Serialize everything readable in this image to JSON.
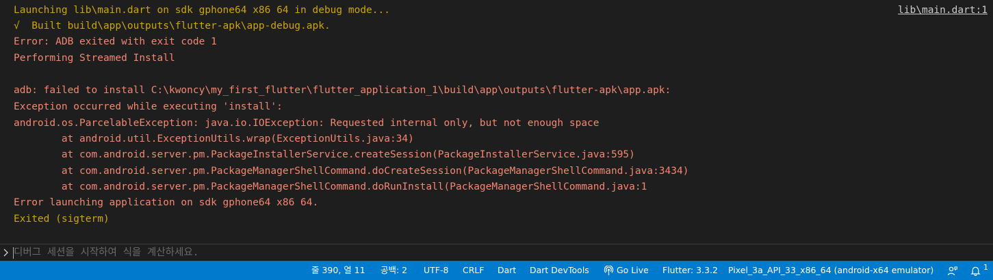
{
  "console": {
    "lines": [
      {
        "text": "Launching lib\\main.dart on sdk gphone64 x86 64 in debug mode...",
        "tone": "yellow"
      },
      {
        "text": "√  Built build\\app\\outputs\\flutter-apk\\app-debug.apk.",
        "tone": "yellow"
      },
      {
        "text": "Error: ADB exited with exit code 1",
        "tone": "red"
      },
      {
        "text": "Performing Streamed Install",
        "tone": "red"
      },
      {
        "text": "",
        "tone": "red"
      },
      {
        "text": "adb: failed to install C:\\kwoncy\\my_first_flutter\\flutter_application_1\\build\\app\\outputs\\flutter-apk\\app.apk:",
        "tone": "red"
      },
      {
        "text": "Exception occurred while executing 'install':",
        "tone": "red"
      },
      {
        "text": "android.os.ParcelableException: java.io.IOException: Requested internal only, but not enough space",
        "tone": "red"
      },
      {
        "text": "        at android.util.ExceptionUtils.wrap(ExceptionUtils.java:34)",
        "tone": "red"
      },
      {
        "text": "        at com.android.server.pm.PackageInstallerService.createSession(PackageInstallerService.java:595)",
        "tone": "red"
      },
      {
        "text": "        at com.android.server.pm.PackageManagerShellCommand.doCreateSession(PackageManagerShellCommand.java:3434)",
        "tone": "red"
      },
      {
        "text": "        at com.android.server.pm.PackageManagerShellCommand.doRunInstall(PackageManagerShellCommand.java:1",
        "tone": "red"
      },
      {
        "text": "Error launching application on sdk gphone64 x86 64.",
        "tone": "red"
      },
      {
        "text": "Exited (sigterm)",
        "tone": "yellow"
      }
    ],
    "source_link": "lib\\main.dart:1"
  },
  "repl": {
    "placeholder": "디버그 세션을 시작하여 식을 계산하세요."
  },
  "statusbar": {
    "cursor_position": "줄 390, 열 11",
    "indent": "공백: 2",
    "encoding": "UTF-8",
    "eol": "CRLF",
    "language": "Dart",
    "devtools": "Dart DevTools",
    "go_live": "Go Live",
    "flutter_version": "Flutter: 3.3.2",
    "device": "Pixel_3a_API_33_x86_64 (android-x64 emulator)",
    "notification_count": "1"
  },
  "colors": {
    "background": "#1e1e1e",
    "warning_yellow": "#cca700",
    "error_red": "#f48771",
    "statusbar_blue": "#007acc"
  },
  "icons": {
    "repl": "chevron-right-icon",
    "go_live": "broadcast-icon",
    "feedback": "feedback-person-icon",
    "notifications": "bell-icon"
  }
}
